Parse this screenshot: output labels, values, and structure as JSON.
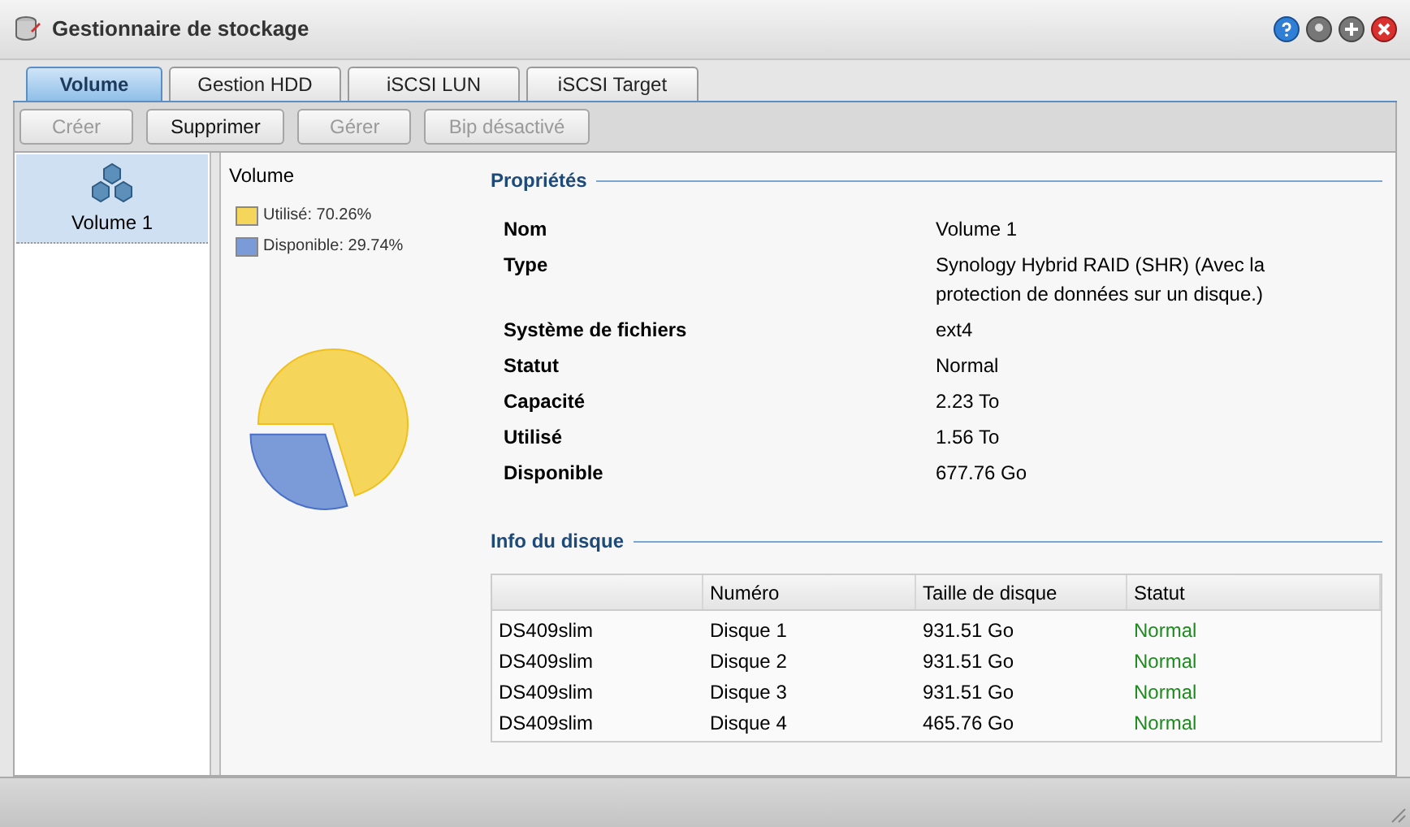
{
  "window": {
    "title": "Gestionnaire de stockage"
  },
  "tabs": [
    {
      "label": "Volume",
      "selected": true
    },
    {
      "label": "Gestion HDD",
      "selected": false
    },
    {
      "label": "iSCSI LUN",
      "selected": false
    },
    {
      "label": "iSCSI Target",
      "selected": false
    }
  ],
  "toolbar": [
    {
      "label": "Créer",
      "disabled": true
    },
    {
      "label": "Supprimer",
      "disabled": false
    },
    {
      "label": "Gérer",
      "disabled": true
    },
    {
      "label": "Bip désactivé",
      "disabled": true
    }
  ],
  "volumes": [
    {
      "label": "Volume 1",
      "selected": true
    }
  ],
  "usage": {
    "title": "Volume",
    "legend": [
      {
        "color": "#f5d55a"
      },
      {
        "color": "#7b9bd8"
      }
    ],
    "chart_data": {
      "type": "pie",
      "categories": [
        "Utilisé: 70.26%",
        "Disponible: 29.74%"
      ],
      "values": [
        70.26,
        29.74
      ]
    }
  },
  "properties": {
    "title": "Propriétés",
    "rows": [
      {
        "label": "Nom",
        "value": "Volume 1"
      },
      {
        "label": "Type",
        "value": "Synology Hybrid RAID (SHR) (Avec la protection de données sur un disque.)"
      },
      {
        "label": "Système de fichiers",
        "value": "ext4"
      },
      {
        "label": "Statut",
        "value": "Normal"
      },
      {
        "label": "Capacité",
        "value": "2.23 To"
      },
      {
        "label": "Utilisé",
        "value": "1.56 To"
      },
      {
        "label": "Disponible",
        "value": "677.76 Go"
      }
    ]
  },
  "disk_info": {
    "title": "Info du disque",
    "columns": [
      "",
      "Numéro",
      "Taille de disque",
      "Statut"
    ],
    "rows": [
      {
        "cells": [
          "DS409slim",
          "Disque 1",
          "931.51 Go",
          "Normal"
        ],
        "color": "#1f8a1f"
      },
      {
        "cells": [
          "DS409slim",
          "Disque 2",
          "931.51 Go",
          "Normal"
        ],
        "color": "#1f8a1f"
      },
      {
        "cells": [
          "DS409slim",
          "Disque 3",
          "931.51 Go",
          "Normal"
        ],
        "color": "#1f8a1f"
      },
      {
        "cells": [
          "DS409slim",
          "Disque 4",
          "465.76 Go",
          "Normal"
        ],
        "color": "#1f8a1f"
      }
    ]
  }
}
